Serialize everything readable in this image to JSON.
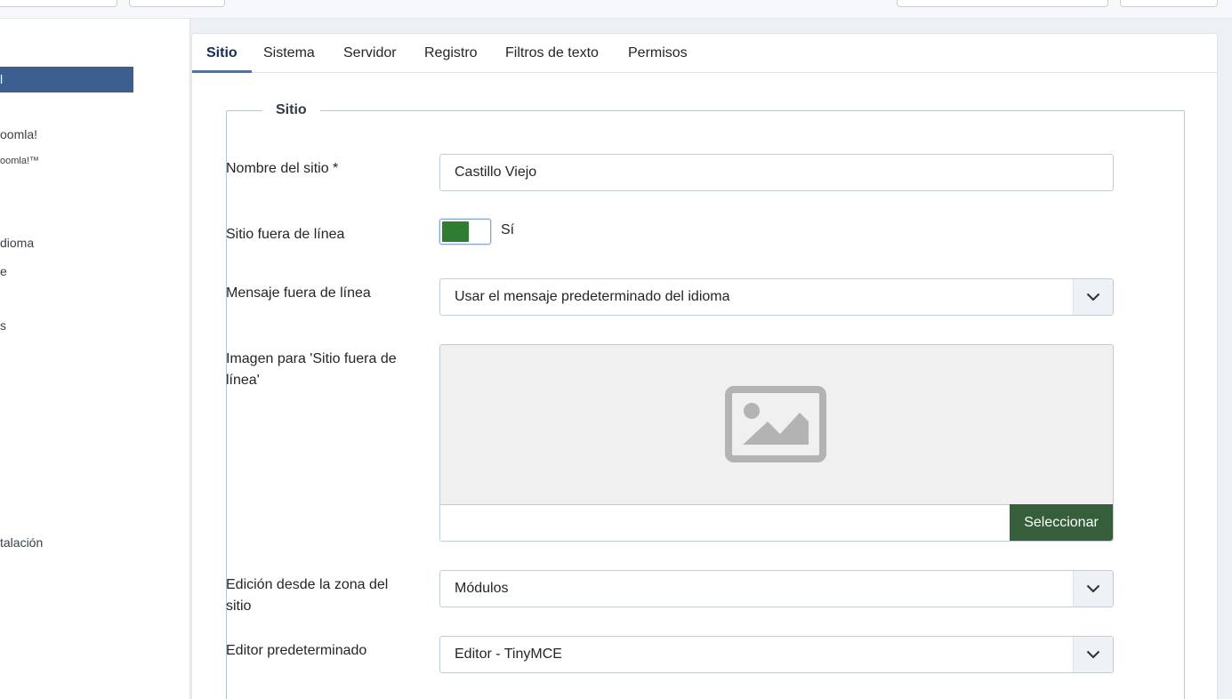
{
  "sidebar": {
    "active_item": "l",
    "items": [
      {
        "label": "oomla!"
      },
      {
        "label": "oomla!™"
      },
      {
        "label": "dioma"
      },
      {
        "label": "e"
      },
      {
        "label": "s"
      },
      {
        "label": "talación"
      }
    ]
  },
  "tabs": [
    {
      "label": "Sitio",
      "active": true
    },
    {
      "label": "Sistema"
    },
    {
      "label": "Servidor"
    },
    {
      "label": "Registro"
    },
    {
      "label": "Filtros de texto"
    },
    {
      "label": "Permisos"
    }
  ],
  "form": {
    "legend": "Sitio",
    "site_name": {
      "label": "Nombre del sitio *",
      "value": "Castillo Viejo"
    },
    "offline": {
      "label": "Sitio fuera de línea",
      "state_label": "Sí",
      "on": true
    },
    "offline_message": {
      "label": "Mensaje fuera de línea",
      "value": "Usar el mensaje predeterminado del idioma"
    },
    "offline_image": {
      "label": "Imagen para 'Sitio fuera de línea'",
      "button": "Seleccionar",
      "path_value": ""
    },
    "frontend_editing": {
      "label": "Edición desde la zona del sitio",
      "value": "Módulos"
    },
    "default_editor": {
      "label": "Editor predeterminado",
      "value": "Editor - TinyMCE"
    }
  },
  "colors": {
    "sidebar_active": "#3c5f8f",
    "toggle_on": "#2e7d32",
    "select_button": "#355e3b",
    "tab_active_border": "#4474b3"
  },
  "icons": {
    "chevron": "chevron-down-icon",
    "image_placeholder": "image-icon"
  }
}
